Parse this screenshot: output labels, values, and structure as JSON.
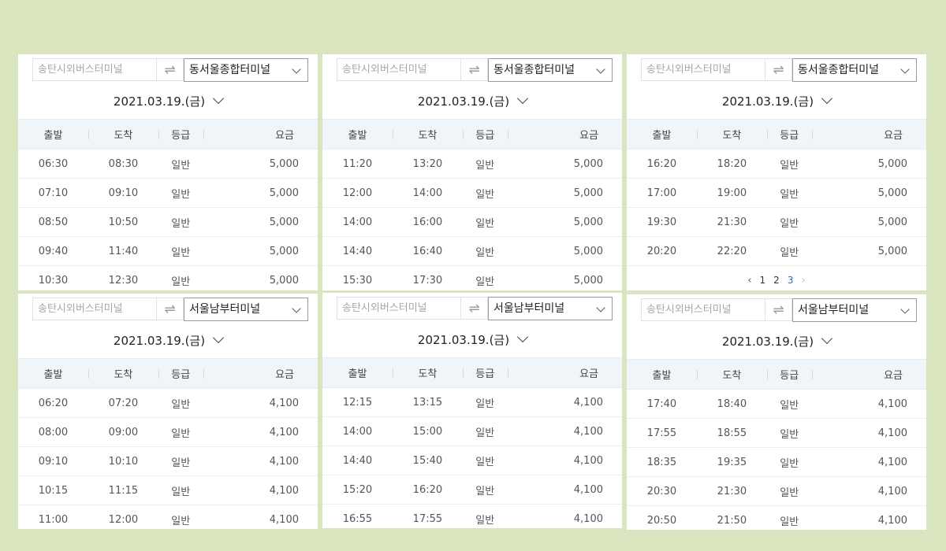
{
  "header": {
    "dep": "출발",
    "arr": "도착",
    "grade": "등급",
    "fare": "요금"
  },
  "panels": [
    {
      "origin": "송탄시외버스터미널",
      "destination": "동서울종합터미널",
      "date": "2021.03.19.(금)",
      "rows": [
        [
          "06:30",
          "08:30",
          "일반",
          "5,000"
        ],
        [
          "07:10",
          "09:10",
          "일반",
          "5,000"
        ],
        [
          "08:50",
          "10:50",
          "일반",
          "5,000"
        ],
        [
          "09:40",
          "11:40",
          "일반",
          "5,000"
        ],
        [
          "10:30",
          "12:30",
          "일반",
          "5,000"
        ]
      ]
    },
    {
      "origin": "송탄시외버스터미널",
      "destination": "동서울종합터미널",
      "date": "2021.03.19.(금)",
      "rows": [
        [
          "11:20",
          "13:20",
          "일반",
          "5,000"
        ],
        [
          "12:00",
          "14:00",
          "일반",
          "5,000"
        ],
        [
          "14:00",
          "16:00",
          "일반",
          "5,000"
        ],
        [
          "14:40",
          "16:40",
          "일반",
          "5,000"
        ],
        [
          "15:30",
          "17:30",
          "일반",
          "5,000"
        ]
      ]
    },
    {
      "origin": "송탄시외버스터미널",
      "destination": "동서울종합터미널",
      "date": "2021.03.19.(금)",
      "rows": [
        [
          "16:20",
          "18:20",
          "일반",
          "5,000"
        ],
        [
          "17:00",
          "19:00",
          "일반",
          "5,000"
        ],
        [
          "19:30",
          "21:30",
          "일반",
          "5,000"
        ],
        [
          "20:20",
          "22:20",
          "일반",
          "5,000"
        ]
      ],
      "pagination": {
        "pages": [
          "1",
          "2",
          "3"
        ],
        "current": "3",
        "prev_icon": "chevron-left-icon",
        "next_icon": "chevron-right-icon"
      }
    },
    {
      "origin": "송탄시외버스터미널",
      "destination": "서울남부터미널",
      "date": "2021.03.19.(금)",
      "rows": [
        [
          "06:20",
          "07:20",
          "일반",
          "4,100"
        ],
        [
          "08:00",
          "09:00",
          "일반",
          "4,100"
        ],
        [
          "09:10",
          "10:10",
          "일반",
          "4,100"
        ],
        [
          "10:15",
          "11:15",
          "일반",
          "4,100"
        ],
        [
          "11:00",
          "12:00",
          "일반",
          "4,100"
        ]
      ]
    },
    {
      "origin": "송탄시외버스터미널",
      "destination": "서울남부터미널",
      "date": "2021.03.19.(금)",
      "rows": [
        [
          "12:15",
          "13:15",
          "일반",
          "4,100"
        ],
        [
          "14:00",
          "15:00",
          "일반",
          "4,100"
        ],
        [
          "14:40",
          "15:40",
          "일반",
          "4,100"
        ],
        [
          "15:20",
          "16:20",
          "일반",
          "4,100"
        ],
        [
          "16:55",
          "17:55",
          "일반",
          "4,100"
        ]
      ]
    },
    {
      "origin": "송탄시외버스터미널",
      "destination": "서울남부터미널",
      "date": "2021.03.19.(금)",
      "rows": [
        [
          "17:40",
          "18:40",
          "일반",
          "4,100"
        ],
        [
          "17:55",
          "18:55",
          "일반",
          "4,100"
        ],
        [
          "18:35",
          "19:35",
          "일반",
          "4,100"
        ],
        [
          "20:30",
          "21:30",
          "일반",
          "4,100"
        ],
        [
          "20:50",
          "21:50",
          "일반",
          "4,100"
        ]
      ]
    }
  ],
  "colors": {
    "background": "#d9e5be",
    "header_bg": "#f0f5fa",
    "page_active": "#1a6fc9"
  }
}
